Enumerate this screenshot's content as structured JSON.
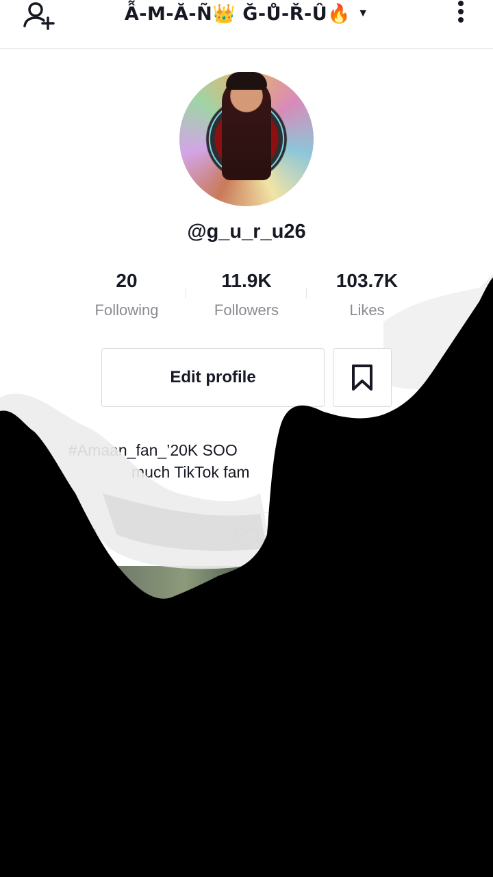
{
  "header": {
    "title": "Ẫ-M-Ă-Ñ👑 Ğ-Ů-Ř-Û🔥",
    "dropdown_icon": "caret-down-icon",
    "left_icon": "add-user-icon",
    "right_icon": "more-vertical-icon"
  },
  "profile": {
    "handle": "@g_u_r_u26",
    "avatar_icon": "profile-avatar"
  },
  "stats": [
    {
      "value": "20",
      "label": "Following"
    },
    {
      "value": "11.9K",
      "label": "Followers"
    },
    {
      "value": "103.7K",
      "label": "Likes"
    }
  ],
  "actions": {
    "edit_profile": "Edit profile",
    "bookmark_icon": "bookmark-icon"
  },
  "bio": {
    "line1": "#Amaan_fan_’20K SOO",
    "line2": "much TikTok fam"
  },
  "tabs": {
    "videos_icon": "videos-grid-icon",
    "liked_icon": "heart-icon"
  },
  "colors": {
    "text": "#161823",
    "secondary_text": "#8a8b91",
    "divider": "#e3e3e4",
    "overlay": "#000000"
  }
}
